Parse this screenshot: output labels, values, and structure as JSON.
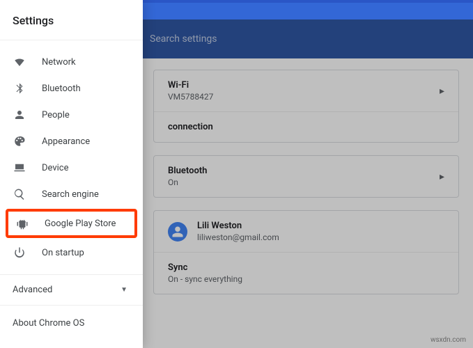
{
  "topbar": {},
  "search": {
    "placeholder": "Search settings"
  },
  "sidebar": {
    "title": "Settings",
    "items": [
      {
        "label": "Network"
      },
      {
        "label": "Bluetooth"
      },
      {
        "label": "People"
      },
      {
        "label": "Appearance"
      },
      {
        "label": "Device"
      },
      {
        "label": "Search engine"
      },
      {
        "label": "Google Play Store"
      },
      {
        "label": "On startup"
      }
    ],
    "advanced": "Advanced",
    "about": "About Chrome OS"
  },
  "content": {
    "wifi": {
      "title": "Wi-Fi",
      "sub": "VM5788427"
    },
    "connection_label": "connection",
    "bluetooth": {
      "title": "Bluetooth",
      "sub": "On"
    },
    "people": {
      "name": "Lili Weston",
      "email": "liliweston@gmail.com",
      "sync_title": "Sync",
      "sync_sub": "On - sync everything"
    }
  },
  "watermark": "wsxdn.com"
}
